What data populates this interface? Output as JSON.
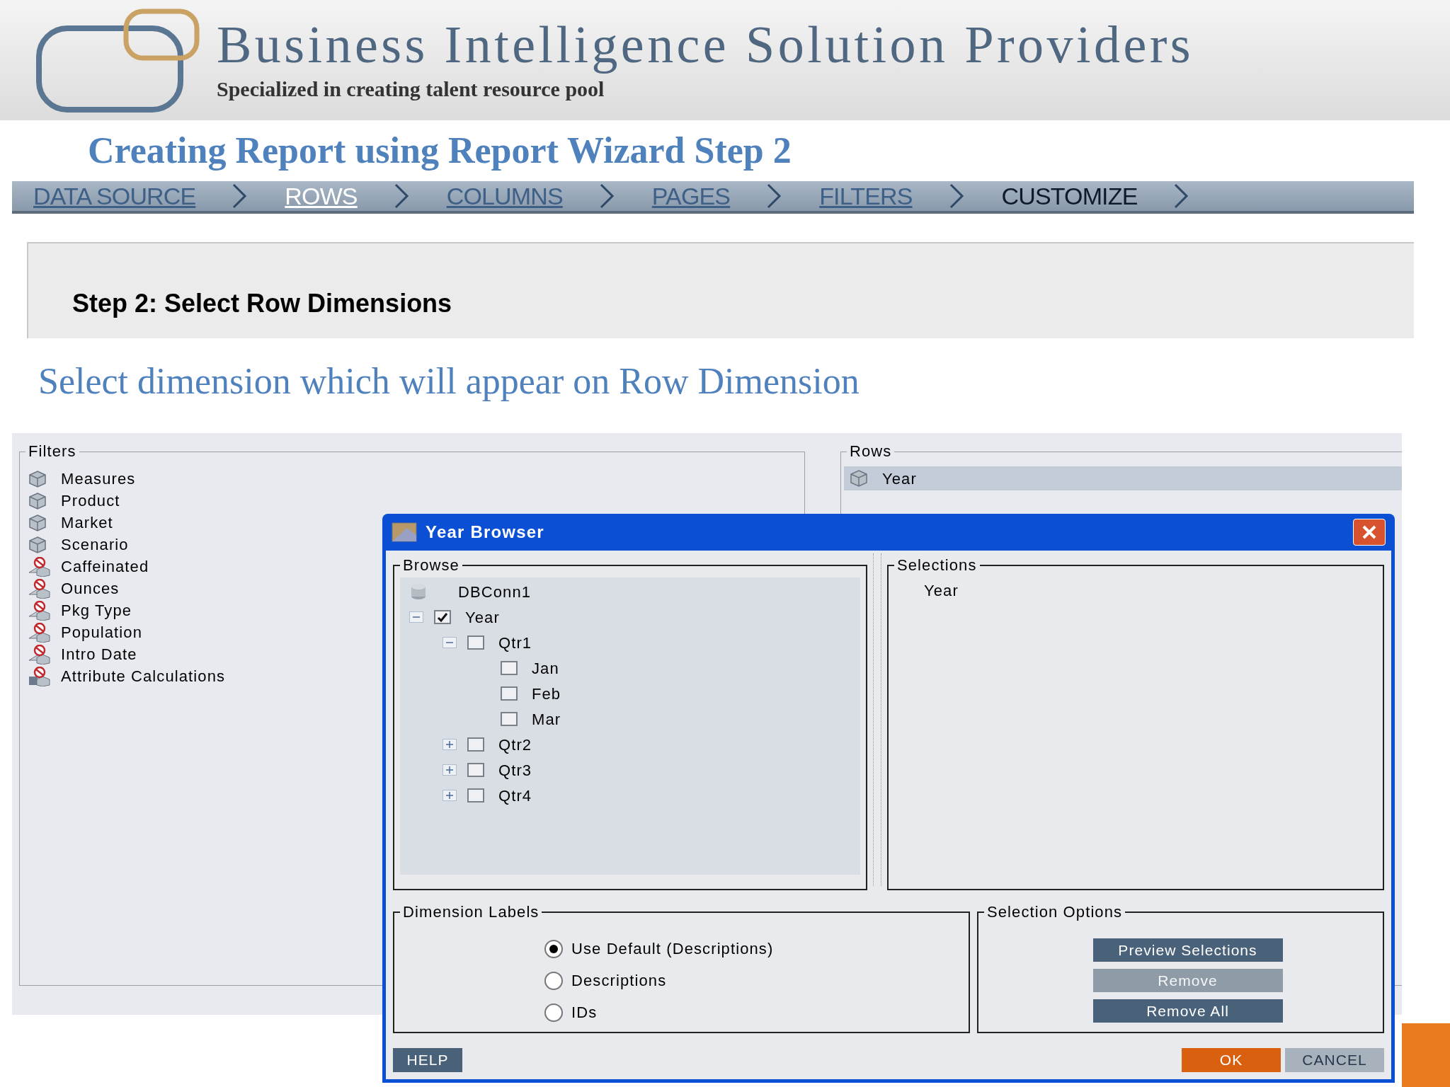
{
  "header": {
    "company": "Business Intelligence Solution Providers",
    "tagline": "Specialized in creating talent resource pool"
  },
  "slide_title": "Creating Report using Report Wizard Step 2",
  "wizard_steps": [
    {
      "label": "DATA SOURCE",
      "selected": false,
      "underlined": true
    },
    {
      "label": "ROWS",
      "selected": true,
      "underlined": true
    },
    {
      "label": "COLUMNS",
      "selected": false,
      "underlined": true
    },
    {
      "label": "PAGES",
      "selected": false,
      "underlined": true
    },
    {
      "label": "FILTERS",
      "selected": false,
      "underlined": true
    },
    {
      "label": "CUSTOMIZE",
      "selected": false,
      "underlined": false
    }
  ],
  "step_heading": "Step 2: Select Row Dimensions",
  "instruction": "Select dimension which will appear on Row Dimension",
  "filters": {
    "title": "Filters",
    "items": [
      {
        "label": "Measures",
        "kind": "dimension"
      },
      {
        "label": "Product",
        "kind": "dimension"
      },
      {
        "label": "Market",
        "kind": "dimension"
      },
      {
        "label": "Scenario",
        "kind": "dimension"
      },
      {
        "label": "Caffeinated",
        "kind": "attribute"
      },
      {
        "label": "Ounces",
        "kind": "attribute"
      },
      {
        "label": "Pkg Type",
        "kind": "attribute"
      },
      {
        "label": "Population",
        "kind": "attribute"
      },
      {
        "label": "Intro Date",
        "kind": "attribute"
      },
      {
        "label": "Attribute Calculations",
        "kind": "calculation"
      }
    ]
  },
  "rows": {
    "title": "Rows",
    "items": [
      {
        "label": "Year",
        "selected": true
      }
    ]
  },
  "dialog": {
    "title": "Year Browser",
    "browse": {
      "title": "Browse",
      "tree": [
        {
          "label": "DBConn1",
          "kind": "connection"
        },
        {
          "label": "Year",
          "kind": "member",
          "checked": true,
          "expanded": true,
          "children": [
            {
              "label": "Qtr1",
              "kind": "member",
              "checked": false,
              "expanded": true,
              "children": [
                {
                  "label": "Jan",
                  "kind": "member",
                  "checked": false
                },
                {
                  "label": "Feb",
                  "kind": "member",
                  "checked": false
                },
                {
                  "label": "Mar",
                  "kind": "member",
                  "checked": false
                }
              ]
            },
            {
              "label": "Qtr2",
              "kind": "member",
              "checked": false,
              "expanded": false
            },
            {
              "label": "Qtr3",
              "kind": "member",
              "checked": false,
              "expanded": false
            },
            {
              "label": "Qtr4",
              "kind": "member",
              "checked": false,
              "expanded": false
            }
          ]
        }
      ]
    },
    "selections": {
      "title": "Selections",
      "items": [
        "Year"
      ]
    },
    "dimension_labels": {
      "title": "Dimension Labels",
      "options": [
        {
          "label": "Use Default (Descriptions)",
          "selected": true
        },
        {
          "label": "Descriptions",
          "selected": false
        },
        {
          "label": "IDs",
          "selected": false
        }
      ]
    },
    "selection_options": {
      "title": "Selection Options",
      "buttons": [
        {
          "label": "Preview Selections",
          "disabled": false
        },
        {
          "label": "Remove",
          "disabled": true
        },
        {
          "label": "Remove All",
          "disabled": false
        }
      ]
    },
    "footer": {
      "help": "HELP",
      "ok": "OK",
      "cancel": "CANCEL"
    }
  }
}
